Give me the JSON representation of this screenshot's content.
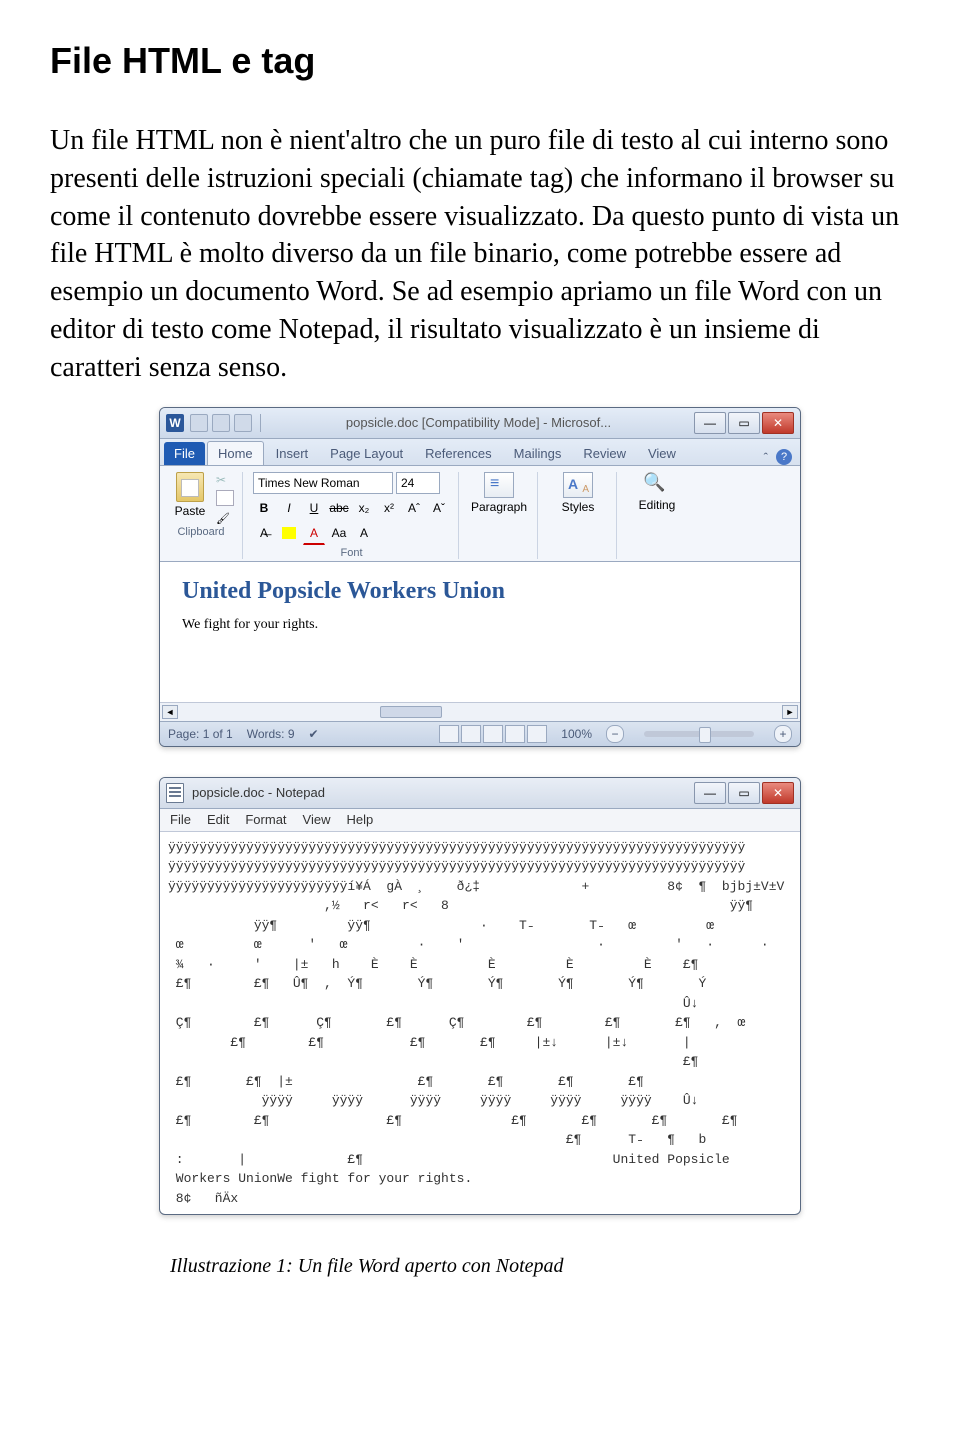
{
  "heading": "File HTML e tag",
  "paragraph": "Un file HTML non è nient'altro che un puro file di testo al cui interno sono presenti delle istruzioni speciali (chiamate tag) che informano il browser su come il contenuto dovrebbe essere visualizzato. Da questo punto di vista un file HTML è molto diverso da un file binario, come potrebbe essere ad esempio un documento Word. Se ad esempio apriamo un file Word con un editor di testo come Notepad, il risultato visualizzato è un insieme di caratteri senza senso.",
  "word": {
    "appIcon": "W",
    "title": "popsicle.doc [Compatibility Mode] - Microsof...",
    "qat": [
      "save",
      "undo",
      "redo"
    ],
    "tabs": [
      "File",
      "Home",
      "Insert",
      "Page Layout",
      "References",
      "Mailings",
      "Review",
      "View"
    ],
    "activeTab": "Home",
    "font": {
      "name": "Times New Roman",
      "size": "24"
    },
    "groups": {
      "clipboard": "Clipboard",
      "font": "Font",
      "paragraph": "Paragraph",
      "styles": "Styles",
      "editing": "Editing"
    },
    "paste": "Paste",
    "doc": {
      "title": "United Popsicle Workers Union",
      "sub": "We fight for your rights."
    },
    "status": {
      "page": "Page: 1 of 1",
      "words": "Words: 9",
      "zoom": "100%"
    }
  },
  "notepad": {
    "title": "popsicle.doc - Notepad",
    "menu": [
      "File",
      "Edit",
      "Format",
      "View",
      "Help"
    ],
    "lines": [
      "ÿÿÿÿÿÿÿÿÿÿÿÿÿÿÿÿÿÿÿÿÿÿÿÿÿÿÿÿÿÿÿÿÿÿÿÿÿÿÿÿÿÿÿÿÿÿÿÿÿÿÿÿÿÿÿÿÿÿÿÿÿÿÿÿÿÿÿÿÿÿÿÿÿÿ",
      "ÿÿÿÿÿÿÿÿÿÿÿÿÿÿÿÿÿÿÿÿÿÿÿÿÿÿÿÿÿÿÿÿÿÿÿÿÿÿÿÿÿÿÿÿÿÿÿÿÿÿÿÿÿÿÿÿÿÿÿÿÿÿÿÿÿÿÿÿÿÿÿÿÿÿ",
      "ÿÿÿÿÿÿÿÿÿÿÿÿÿÿÿÿÿÿÿÿÿÿÿí¥Á  gÀ  ¸    ð¿‡             +          8¢  ¶  bjbj±V±V",
      "                    ,½   r<   r<   8                                    ÿÿ¶",
      "           ÿÿ¶         ÿÿ¶              ·    T˗       T˗   œ         œ",
      " œ         œ      '   œ         ·    '                 ·         '   ·      ·",
      " ¾   ·     '    |±   h    È    È         È         È         È    £¶",
      " £¶        £¶   Û¶  ,  Ý¶       Ý¶       Ý¶       Ý¶       Ý¶       Ý",
      "                                                                  Û↓",
      " Ç¶        £¶      Ç¶       £¶      Ç¶        £¶        £¶       £¶   ,  œ",
      "        £¶        £¶           £¶       £¶     |±↓      |±↓       |",
      "                                                                  £¶",
      " £¶       £¶  |±                £¶       £¶       £¶       £¶",
      "            ÿÿÿÿ     ÿÿÿÿ      ÿÿÿÿ     ÿÿÿÿ     ÿÿÿÿ     ÿÿÿÿ    Û↓",
      " £¶        £¶               £¶              £¶       £¶       £¶       £¶",
      "                                                   £¶      T˗   ¶   b",
      " :       |             £¶                                United Popsicle",
      " Workers UnionWe fight for your rights.",
      " 8¢   ñÄx"
    ]
  },
  "caption": "Illustrazione 1: Un file Word aperto con Notepad"
}
